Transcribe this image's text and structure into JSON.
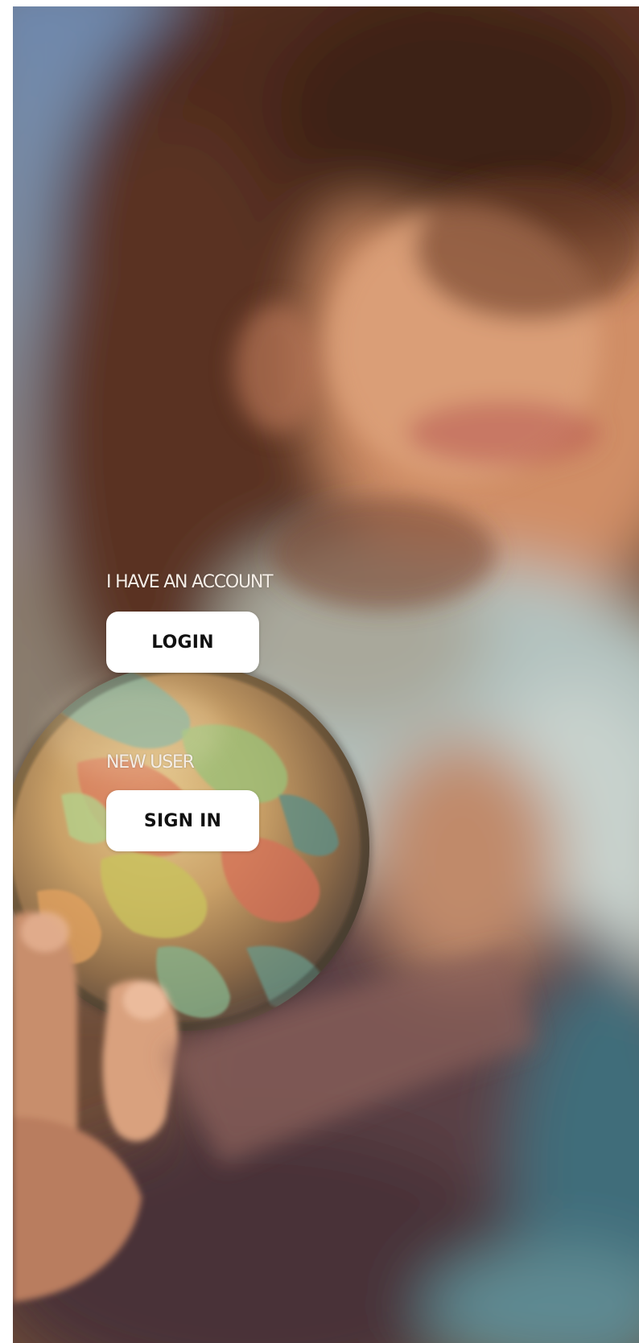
{
  "background": {
    "image": "blurred-girl-holding-globe-photo",
    "accent_colors": {
      "sky": "#5c77a0",
      "hair": "#5a3322",
      "skin": "#d69670",
      "shirt": "#b7c7c5",
      "globe": "#c79e63"
    }
  },
  "auth": {
    "account_label": "I HAVE AN ACCOUNT",
    "login_label": "LOGIN",
    "new_user_label": "NEW USER",
    "signin_label": "SIGN IN"
  }
}
